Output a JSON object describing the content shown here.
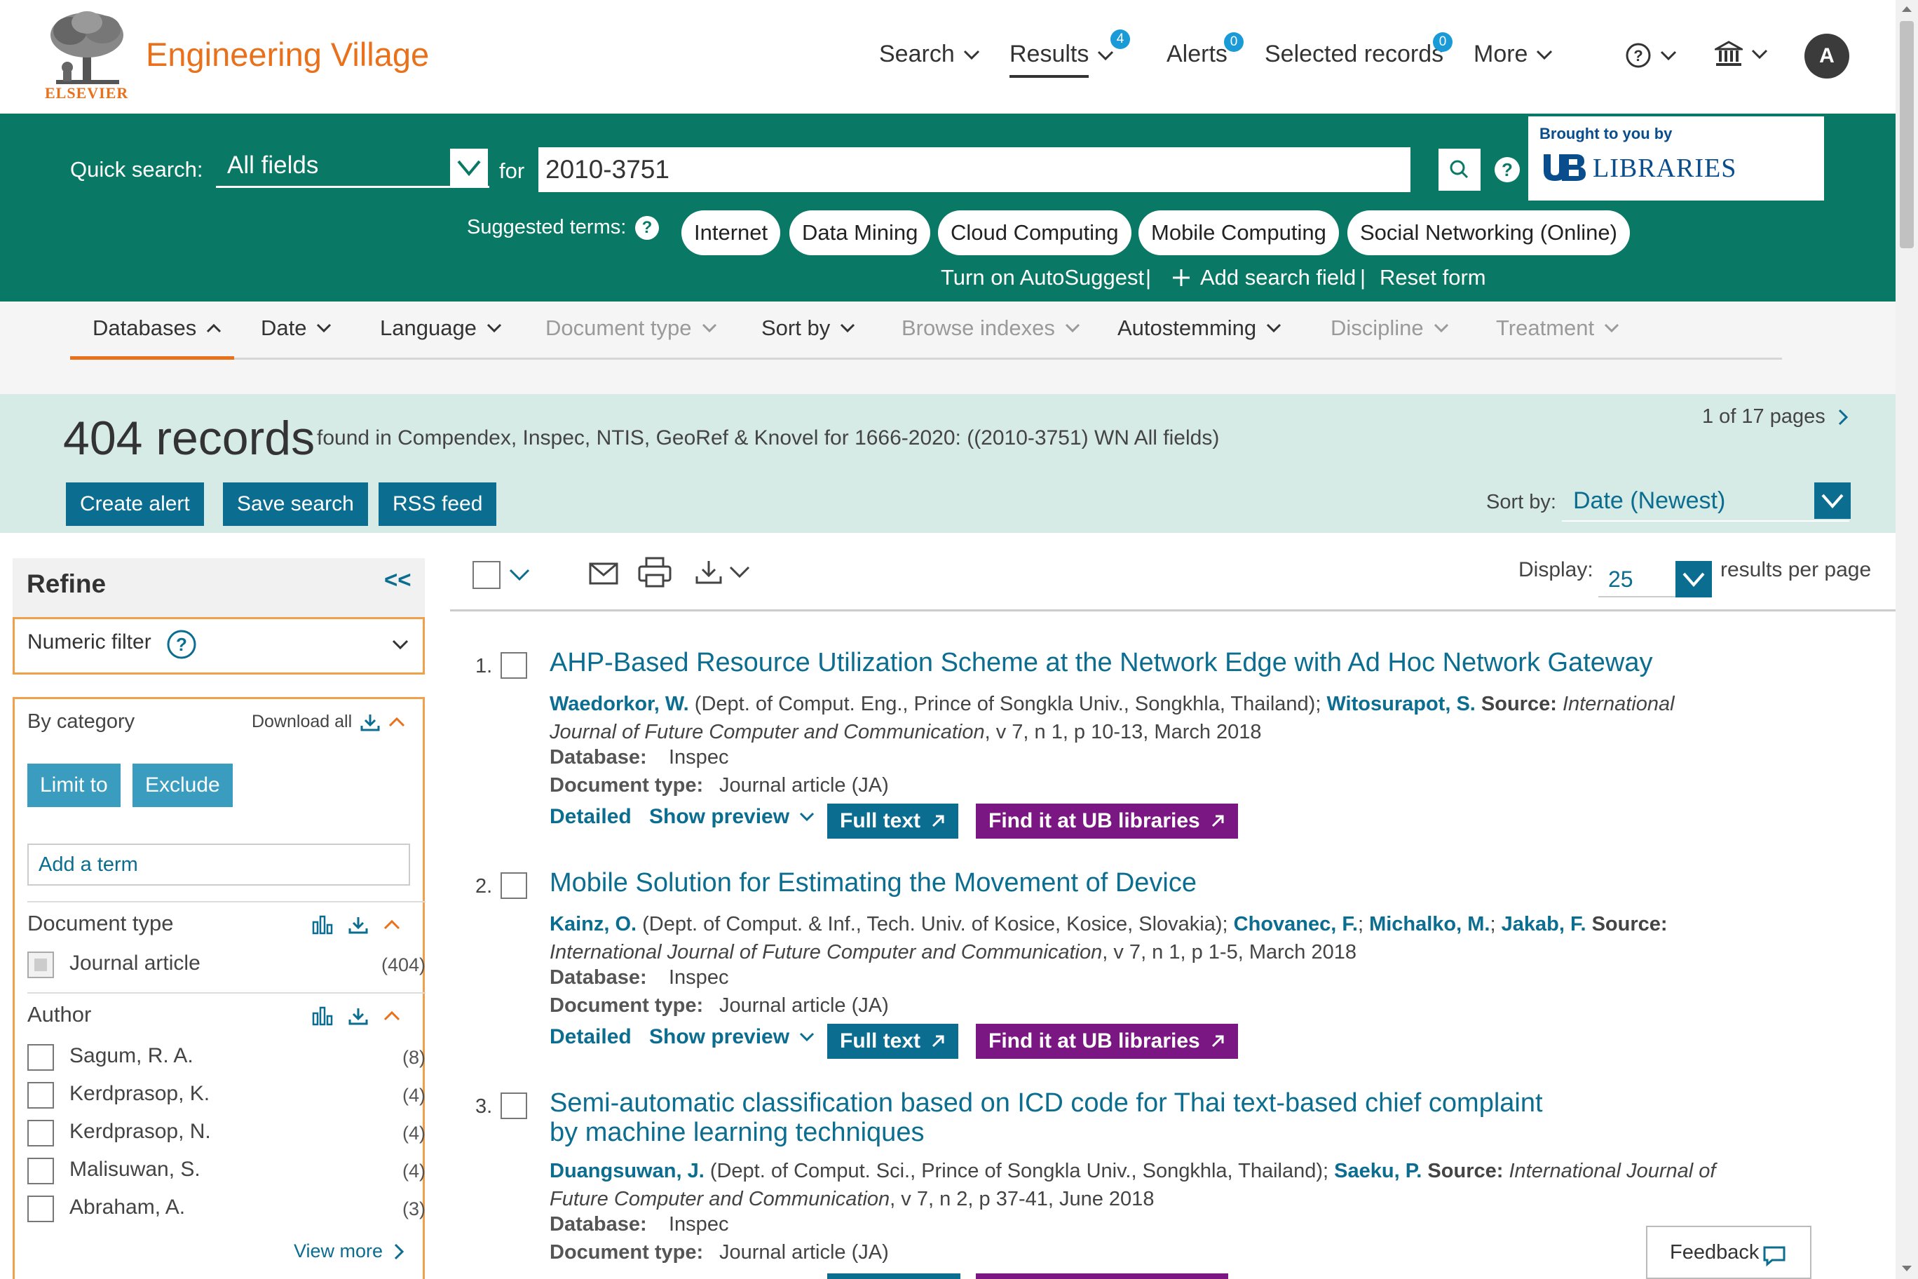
{
  "header": {
    "logo_text": "ELSEVIER",
    "brand": "Engineering Village",
    "nav": {
      "search": "Search",
      "results": "Results",
      "results_badge": "4",
      "alerts": "Alerts",
      "alerts_badge": "0",
      "selected_records": "Selected records",
      "selected_badge": "0",
      "more": "More"
    },
    "avatar_initial": "A"
  },
  "search": {
    "label": "Quick search:",
    "field": "All fields",
    "for_label": "for",
    "query": "2010-3751",
    "brought_by": "Brought to you by",
    "library_name": "LIBRARIES",
    "suggested_label": "Suggested terms:",
    "suggested_terms": [
      "Internet",
      "Data Mining",
      "Cloud Computing",
      "Mobile Computing",
      "Social Networking (Online)"
    ],
    "autosuggest": "Turn on AutoSuggest",
    "add_field": "Add search field",
    "reset": "Reset form"
  },
  "filters": {
    "databases": "Databases",
    "date": "Date",
    "language": "Language",
    "document_type": "Document type",
    "sort_by": "Sort by",
    "browse_indexes": "Browse indexes",
    "autostemming": "Autostemming",
    "discipline": "Discipline",
    "treatment": "Treatment"
  },
  "results_header": {
    "count": "404 records",
    "found_text": "found in Compendex, Inspec, NTIS, GeoRef & Knovel for 1666-2020: ((2010-3751) WN All fields)",
    "pages": "1 of 17 pages",
    "create_alert": "Create alert",
    "save_search": "Save search",
    "rss_feed": "RSS feed",
    "sort_label": "Sort by:",
    "sort_value": "Date (Newest)"
  },
  "refine": {
    "title": "Refine",
    "collapse": "<<",
    "numeric_filter": "Numeric filter",
    "by_category": "By category",
    "download_all": "Download all",
    "limit_to": "Limit to",
    "exclude": "Exclude",
    "add_term": "Add a term",
    "document_type_title": "Document type",
    "document_types": [
      {
        "label": "Journal article",
        "count": "(404)"
      }
    ],
    "author_title": "Author",
    "authors": [
      {
        "label": "Sagum, R. A.",
        "count": "(8)"
      },
      {
        "label": "Kerdprasop, K.",
        "count": "(4)"
      },
      {
        "label": "Kerdprasop, N.",
        "count": "(4)"
      },
      {
        "label": "Malisuwan, S.",
        "count": "(4)"
      },
      {
        "label": "Abraham, A.",
        "count": "(3)"
      }
    ],
    "view_more": "View more"
  },
  "toolbar": {
    "display_label": "Display:",
    "display_value": "25",
    "display_suffix": "results per page"
  },
  "records": [
    {
      "num": "1.",
      "title": "AHP-Based Resource Utilization Scheme at the Network Edge with Ad Hoc Network Gateway",
      "author1": "Waedorkor, W.",
      "affil": " (Dept. of Comput. Eng., Prince of Songkla Univ., Songkhla, Thailand); ",
      "author2": "Witosurapot, S.",
      "source_label": " Source: ",
      "source": "International Journal of Future Computer and Communication",
      "source_detail": ", v 7, n 1, p 10-13, March 2018",
      "database_label": "Database:",
      "database": "Inspec",
      "doctype_label": "Document type:",
      "doctype": "Journal article (JA)",
      "detailed": "Detailed",
      "show_preview": "Show preview",
      "full_text": "Full text",
      "find_it": "Find it at UB libraries"
    },
    {
      "num": "2.",
      "title": "Mobile Solution for Estimating the Movement of Device",
      "author1": "Kainz, O.",
      "affil": " (Dept. of Comput. & Inf., Tech. Univ. of Kosice, Kosice, Slovakia); ",
      "author2": "Chovanec, F.",
      "author3": "Michalko, M.",
      "author4": "Jakab, F.",
      "source_label": " Source: ",
      "source": "International Journal of Future Computer and Communication",
      "source_detail": ", v 7, n 1, p 1-5, March 2018",
      "database_label": "Database:",
      "database": "Inspec",
      "doctype_label": "Document type:",
      "doctype": "Journal article (JA)",
      "detailed": "Detailed",
      "show_preview": "Show preview",
      "full_text": "Full text",
      "find_it": "Find it at UB libraries"
    },
    {
      "num": "3.",
      "title": "Semi-automatic classification based on ICD code for Thai text-based chief complaint by machine learning techniques",
      "author1": "Duangsuwan, J.",
      "affil": " (Dept. of Comput. Sci., Prince of Songkla Univ., Songkhla, Thailand); ",
      "author2": "Saeku, P.",
      "source_label": " Source: ",
      "source": "International Journal of Future Computer and Communication",
      "source_detail": ", v 7, n 2, p 37-41, June 2018",
      "database_label": "Database:",
      "database": "Inspec",
      "doctype_label": "Document type:",
      "doctype": "Journal article (JA)"
    }
  ],
  "feedback": "Feedback"
}
